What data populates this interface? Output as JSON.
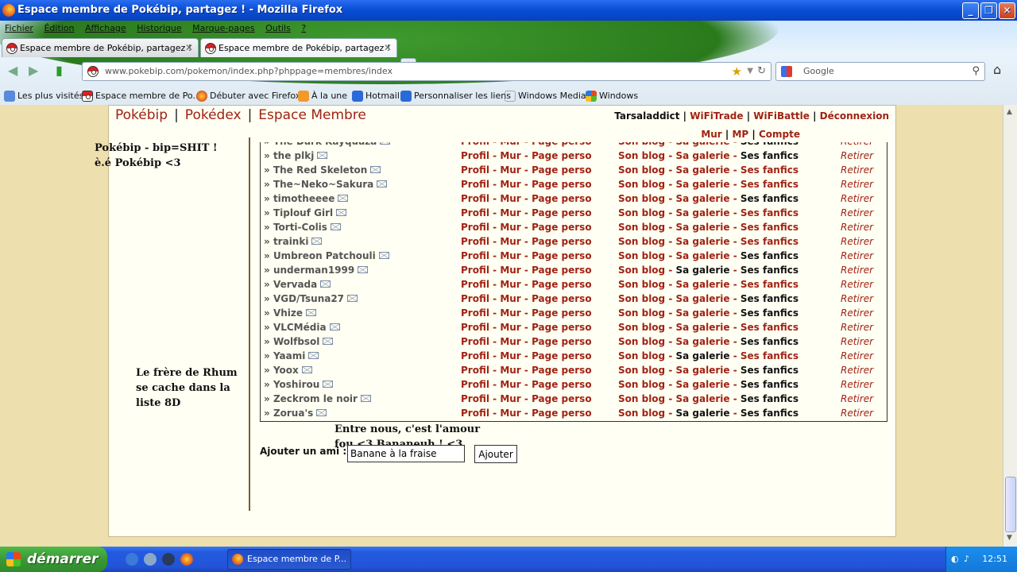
{
  "window": {
    "title": "Espace membre de Pokébip, partagez ! - Mozilla Firefox",
    "min": "_",
    "max": "❐",
    "close": "✕"
  },
  "menu": [
    "Fichier",
    "Édition",
    "Affichage",
    "Historique",
    "Marque-pages",
    "Outils",
    "?"
  ],
  "tabs": [
    {
      "label": "Espace membre de Pokébip, partagez !"
    },
    {
      "label": "Espace membre de Pokébip, partagez !"
    }
  ],
  "url": "www.pokebip.com/pokemon/index.php?phppage=membres/index",
  "search_placeholder": "Google",
  "bookmarks": [
    "Les plus visités",
    "Espace membre de Po...",
    "Débuter avec Firefox",
    "À la une",
    "Hotmail",
    "Personnaliser les liens",
    "Windows Media",
    "Windows"
  ],
  "site": {
    "nav": [
      "Pokébip",
      "Pokédex",
      "Espace Membre"
    ],
    "user": "Tarsaladdict",
    "user_links": [
      "WiFiTrade",
      "WiFiBattle",
      "Déconnexion"
    ],
    "user_links2": [
      "Mur",
      "MP",
      "Compte"
    ]
  },
  "notes": {
    "top": "Pokébip - bip=SHIT !\nè.é Pokébip <3",
    "mid": "Le frère de Rhum\nse cache dans la\nliste 8D",
    "bottom": "Entre nous, c'est l'amour\nfou <3 Bananeuh ! <3"
  },
  "columns": {
    "profil": "Profil",
    "mur": "Mur",
    "perso": "Page perso",
    "blog": "Son blog",
    "galerie": "Sa galerie",
    "fanfics": "Ses fanfics",
    "retirer": "Retirer"
  },
  "friends": [
    {
      "name": "The Dark Kayquaza",
      "g": 1,
      "f": 0
    },
    {
      "name": "the plkj",
      "g": 1,
      "f": 0
    },
    {
      "name": "The Red Skeleton",
      "g": 1,
      "f": 1
    },
    {
      "name": "The~Neko~Sakura",
      "g": 1,
      "f": 1
    },
    {
      "name": "timotheeee",
      "g": 1,
      "f": 0
    },
    {
      "name": "Tiplouf Girl",
      "g": 1,
      "f": 1
    },
    {
      "name": "Torti-Colis",
      "g": 1,
      "f": 1
    },
    {
      "name": "trainki",
      "g": 1,
      "f": 1
    },
    {
      "name": "Umbreon Patchouli",
      "g": 1,
      "f": 0
    },
    {
      "name": "underman1999",
      "g": 0,
      "f": 0
    },
    {
      "name": "Vervada",
      "g": 1,
      "f": 1
    },
    {
      "name": "VGD/Tsuna27",
      "g": 1,
      "f": 0
    },
    {
      "name": "Vhize",
      "g": 1,
      "f": 0
    },
    {
      "name": "VLCMédia",
      "g": 1,
      "f": 1
    },
    {
      "name": "Wolfbsol",
      "g": 1,
      "f": 0
    },
    {
      "name": "Yaami",
      "g": 0,
      "f": 1
    },
    {
      "name": "Yoox",
      "g": 1,
      "f": 0
    },
    {
      "name": "Yoshirou",
      "g": 1,
      "f": 0
    },
    {
      "name": "Zeckrom le noir",
      "g": 1,
      "f": 0
    },
    {
      "name": "Zorua's",
      "g": 0,
      "f": 0
    }
  ],
  "add_friend": {
    "label": "Ajouter un ami :",
    "value": "Banane à la fraise",
    "button": "Ajouter"
  },
  "taskbar": {
    "start": "démarrer",
    "item": "Espace membre de P...",
    "time": "12:51"
  },
  "colors": {
    "accent": "#a02314",
    "page_bg": "#eedfae",
    "panel": "#fffff3"
  }
}
